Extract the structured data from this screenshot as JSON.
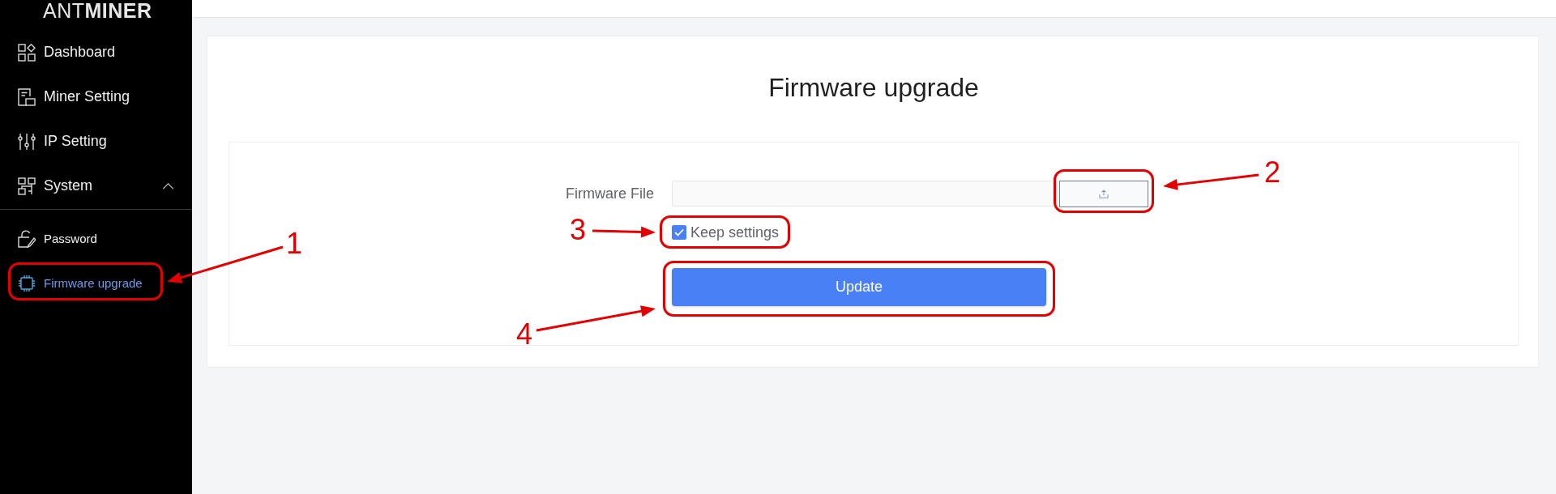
{
  "sidebar": {
    "logo": "ANT**MINER**",
    "items": [
      {
        "label": "Dashboard",
        "selected": false
      },
      {
        "label": "Miner Setting",
        "selected": false
      },
      {
        "label": "IP Setting",
        "selected": false
      },
      {
        "label": "System",
        "selected": false,
        "expanded": true,
        "children": [
          {
            "label": "Password",
            "selected": false
          },
          {
            "label": "Firmware upgrade",
            "selected": true
          }
        ]
      }
    ]
  },
  "content": {
    "title": "Firmware upgrade",
    "file_field": {
      "label": "Firmware File"
    },
    "keep_settings": {
      "label": "Keep settings",
      "checked": true
    },
    "update_button": {
      "label": "Update"
    }
  },
  "annotations": [
    {
      "number": "1"
    },
    {
      "number": "2"
    },
    {
      "number": "3"
    },
    {
      "number": "4"
    }
  ]
}
